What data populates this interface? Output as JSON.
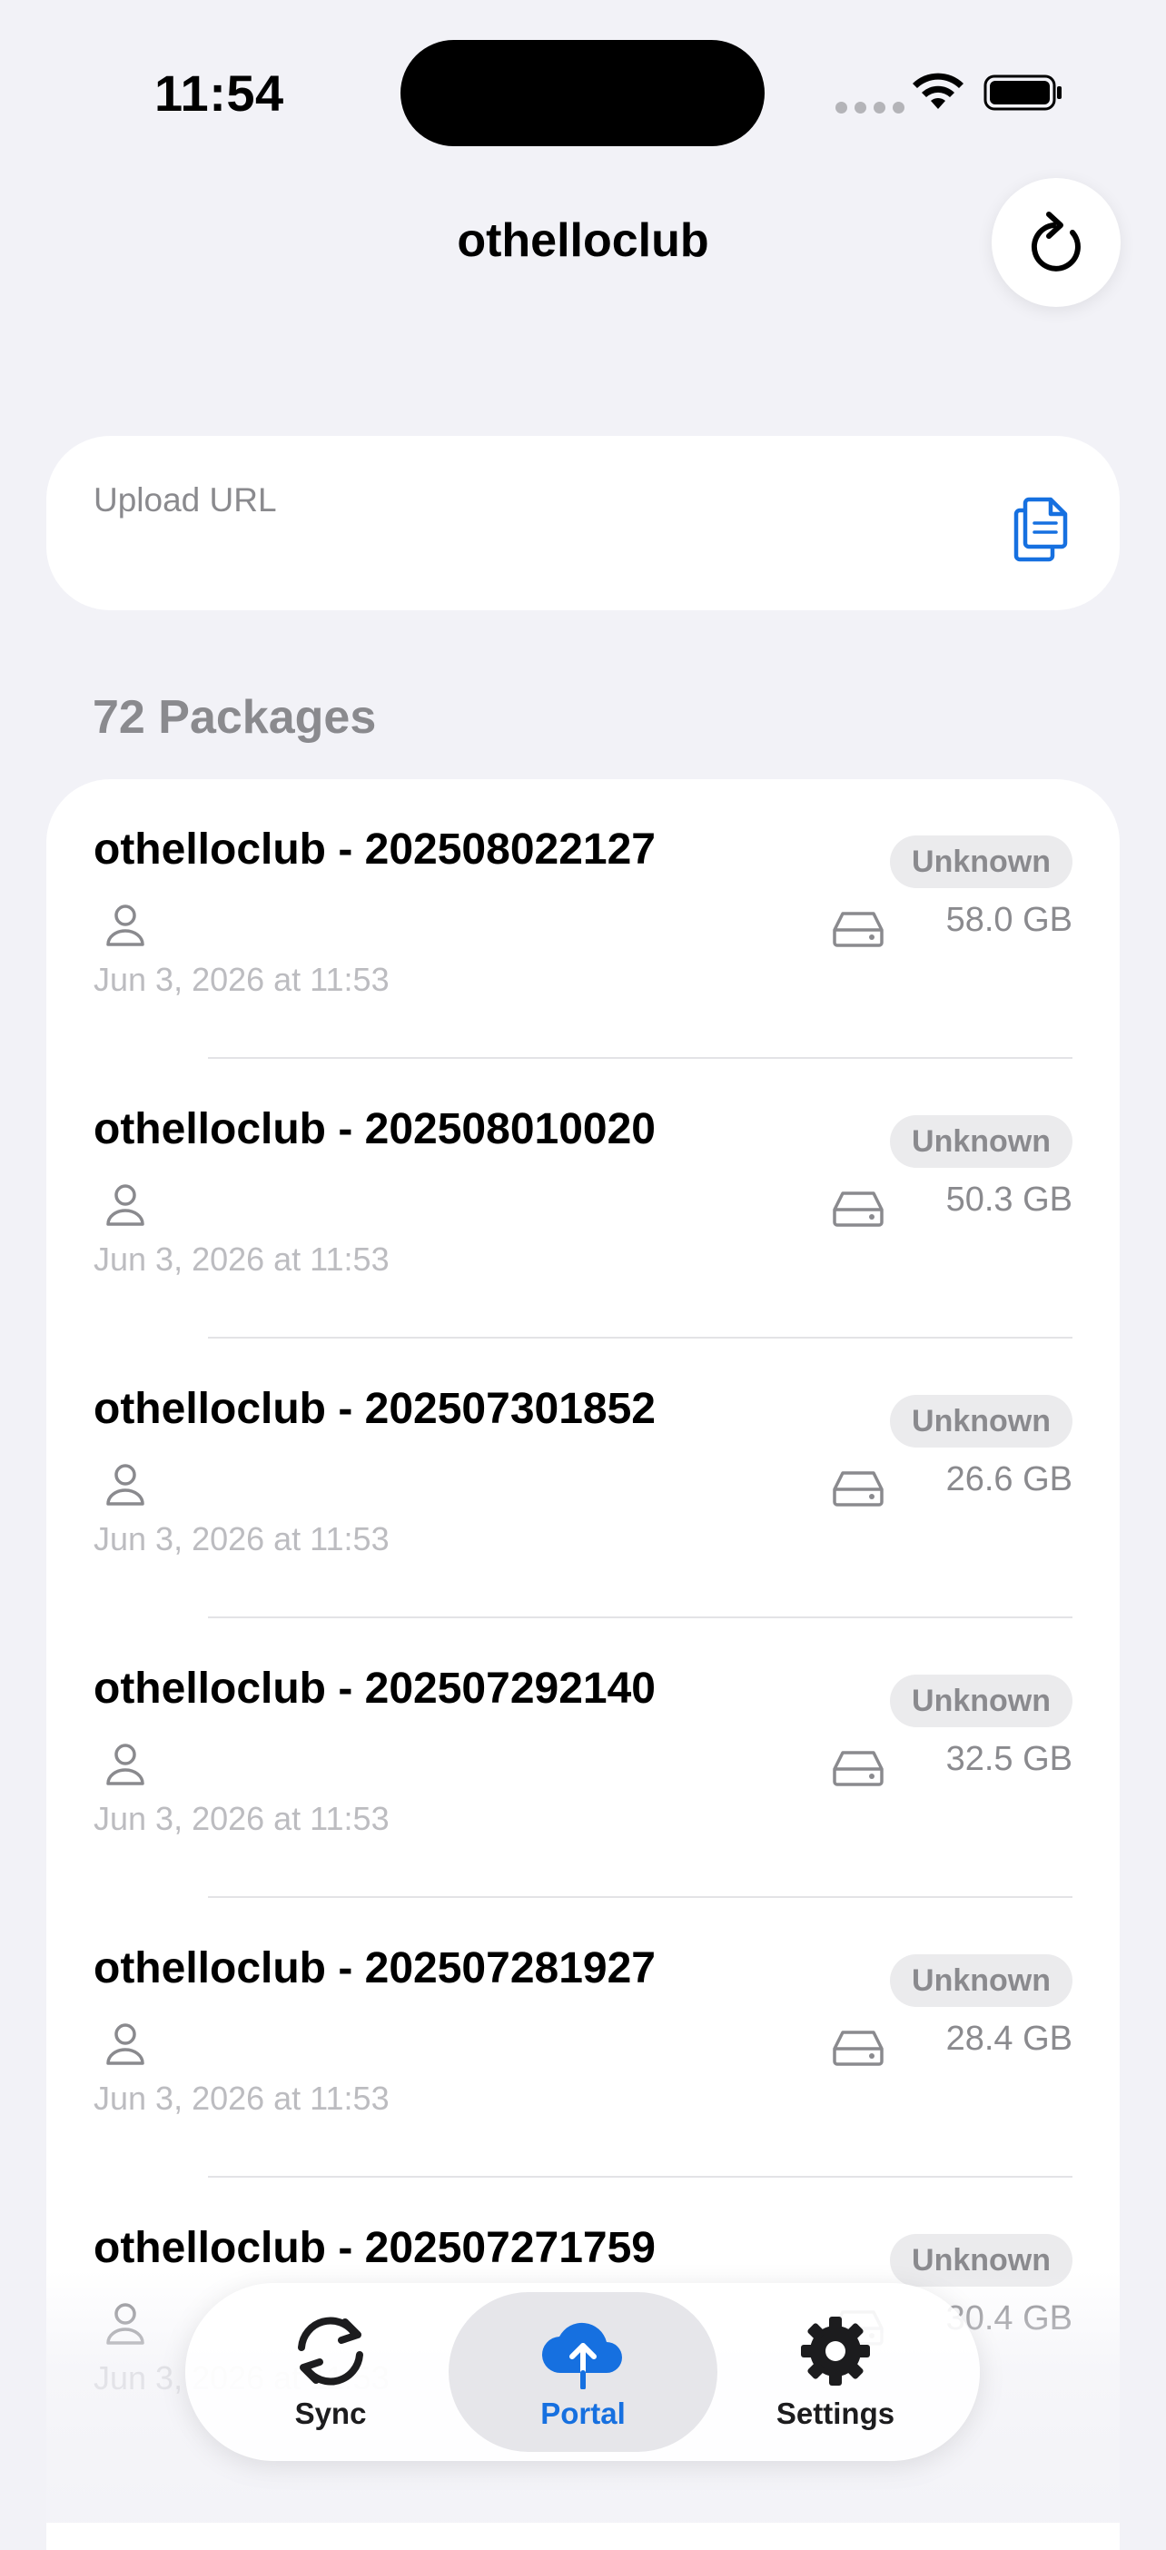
{
  "status_bar": {
    "time": "11:54"
  },
  "nav": {
    "title": "othelloclub"
  },
  "upload": {
    "label": "Upload URL"
  },
  "section": {
    "title": "72 Packages"
  },
  "packages": [
    {
      "title": "othelloclub - 202508022127",
      "status": "Unknown",
      "size": "58.0 GB",
      "date": "Jun 3, 2026 at 11:53"
    },
    {
      "title": "othelloclub - 202508010020",
      "status": "Unknown",
      "size": "50.3 GB",
      "date": "Jun 3, 2026 at 11:53"
    },
    {
      "title": "othelloclub - 202507301852",
      "status": "Unknown",
      "size": "26.6 GB",
      "date": "Jun 3, 2026 at 11:53"
    },
    {
      "title": "othelloclub - 202507292140",
      "status": "Unknown",
      "size": "32.5 GB",
      "date": "Jun 3, 2026 at 11:53"
    },
    {
      "title": "othelloclub - 202507281927",
      "status": "Unknown",
      "size": "28.4 GB",
      "date": "Jun 3, 2026 at 11:53"
    },
    {
      "title": "othelloclub - 202507271759",
      "status": "Unknown",
      "size": "30.4 GB",
      "date": "Jun 3, 2026 at 11:53"
    }
  ],
  "tabbar": {
    "tabs": [
      {
        "label": "Sync",
        "icon": "sync-icon"
      },
      {
        "label": "Portal",
        "icon": "cloud-upload-icon"
      },
      {
        "label": "Settings",
        "icon": "gear-icon"
      }
    ],
    "active_color": "#1670E0"
  }
}
